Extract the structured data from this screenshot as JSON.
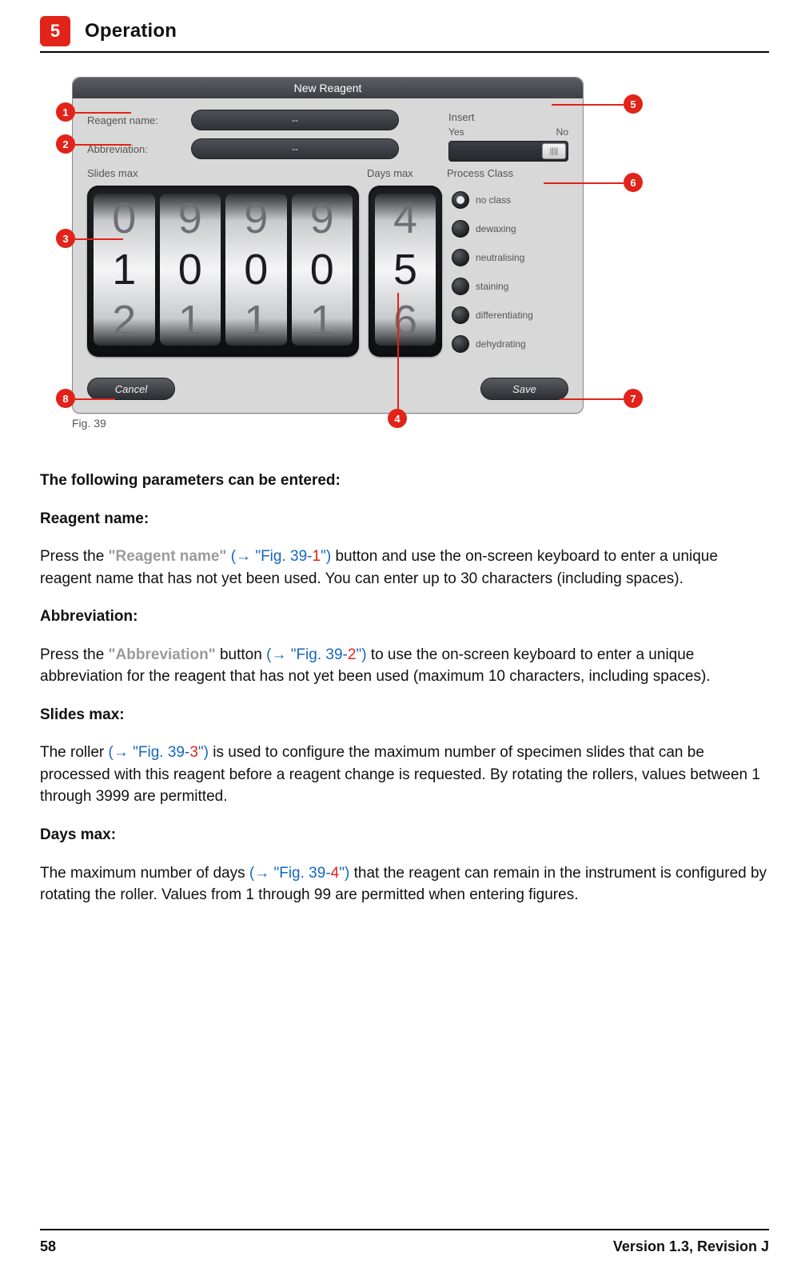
{
  "chapter": {
    "number": "5",
    "title": "Operation"
  },
  "figure": {
    "caption": "Fig. 39",
    "device_title": "New Reagent",
    "reagent_name_label": "Reagent name:",
    "abbreviation_label": "Abbreviation:",
    "reagent_name_value": "--",
    "abbreviation_value": "--",
    "slides_max_label": "Slides max",
    "days_max_label": "Days max",
    "insert_label": "Insert",
    "insert_yes": "Yes",
    "insert_no": "No",
    "process_class_label": "Process Class",
    "process_classes": [
      "no class",
      "dewaxing",
      "neutralising",
      "staining",
      "differentiating",
      "dehydrating"
    ],
    "cancel_label": "Cancel",
    "save_label": "Save",
    "slides_wheels": [
      {
        "top": "0",
        "mid": "1",
        "bot": "2"
      },
      {
        "top": "9",
        "mid": "0",
        "bot": "1"
      },
      {
        "top": "9",
        "mid": "0",
        "bot": "1"
      },
      {
        "top": "9",
        "mid": "0",
        "bot": "1"
      }
    ],
    "days_wheel": {
      "top": "4",
      "mid": "5",
      "bot": "6"
    },
    "callouts": [
      "1",
      "2",
      "3",
      "4",
      "5",
      "6",
      "7",
      "8"
    ]
  },
  "text": {
    "intro": "The following parameters can be entered:",
    "h_reagent": "Reagent name:",
    "p_reagent_a": "Press the ",
    "p_reagent_link1": "\"Reagent name\"",
    "p_reagent_paren_open": " (→ ",
    "p_reagent_figref": "\"Fig. 39-",
    "p_reagent_num": "1",
    "p_reagent_figref_close": "\"",
    "p_reagent_paren_close": ") ",
    "p_reagent_b": "button and use the on-screen keyboard to enter a unique reagent name that has not yet been used. You can enter up to 30 characters (including spaces).",
    "h_abbrev": "Abbreviation:",
    "p_abbrev_a": "Press the ",
    "p_abbrev_link1": "\"Abbreviation\"",
    "p_abbrev_mid": " button ",
    "p_abbrev_paren_open": "(→ ",
    "p_abbrev_figref": "\"Fig. 39-",
    "p_abbrev_num": "2",
    "p_abbrev_figref_close": "\"",
    "p_abbrev_paren_close": ") ",
    "p_abbrev_b": "to use the on-screen keyboard to enter a unique abbreviation for the reagent that has not yet been used (maximum 10 characters, including spaces).",
    "h_slides": "Slides max:",
    "p_slides_a": "The roller ",
    "p_slides_paren_open": "(→ ",
    "p_slides_figref": "\"Fig. 39-",
    "p_slides_num": "3",
    "p_slides_figref_close": "\"",
    "p_slides_paren_close": ") ",
    "p_slides_b": "is used to configure the maximum number of specimen slides that can be processed with this reagent before a reagent change is requested. By rotating the rollers, values between 1 through 3999 are permitted.",
    "h_days": "Days max:",
    "p_days_a": "The maximum number of days ",
    "p_days_paren_open": "(→ ",
    "p_days_figref": "\"Fig. 39-",
    "p_days_num": "4",
    "p_days_figref_close": "\"",
    "p_days_paren_close": ") ",
    "p_days_b": "that the reagent can remain in the instrument is configured by rotating the roller. Values from 1 through 99 are permitted when entering figures."
  },
  "footer": {
    "page": "58",
    "version": "Version 1.3, Revision J"
  }
}
